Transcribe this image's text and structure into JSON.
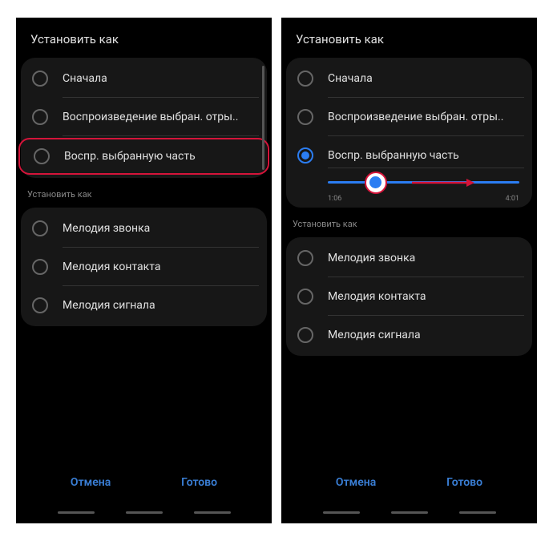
{
  "left": {
    "header": "Установить как",
    "play": {
      "opt1": "Сначала",
      "opt2": "Воспроизведение выбран. отры..",
      "opt3": "Воспр. выбранную часть"
    },
    "sub": "Установить как",
    "set": {
      "opt1": "Мелодия звонка",
      "opt2": "Мелодия контакта",
      "opt3": "Мелодия сигнала"
    },
    "cancel": "Отмена",
    "done": "Готово"
  },
  "right": {
    "header": "Установить как",
    "play": {
      "opt1": "Сначала",
      "opt2": "Воспроизведение выбран. отры..",
      "opt3": "Воспр. выбранную часть"
    },
    "time_start": "1:06",
    "time_end": "4:01",
    "sub": "Установить как",
    "set": {
      "opt1": "Мелодия звонка",
      "opt2": "Мелодия контакта",
      "opt3": "Мелодия сигнала"
    },
    "cancel": "Отмена",
    "done": "Готово"
  }
}
